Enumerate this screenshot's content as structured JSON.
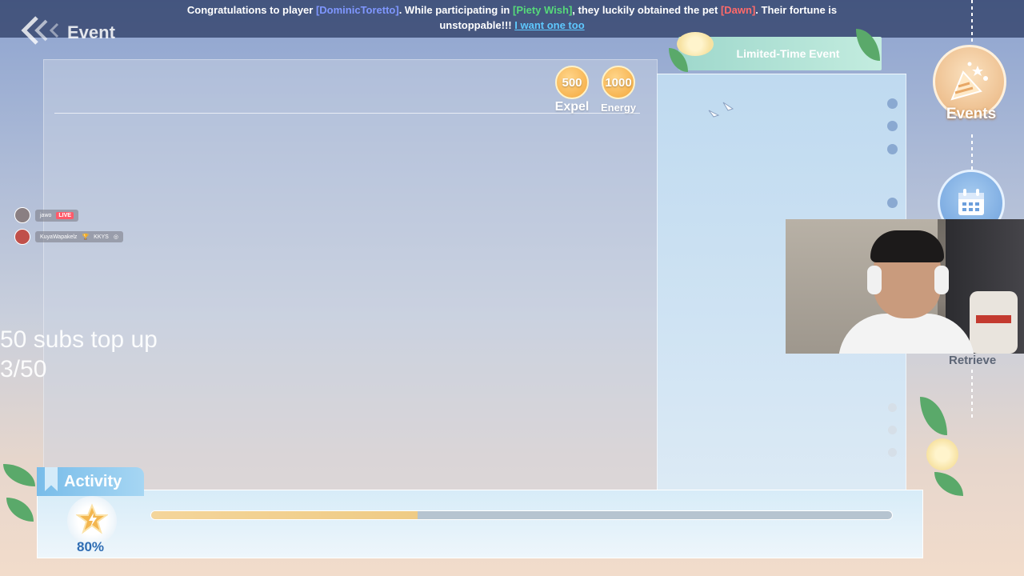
{
  "announcement": {
    "line1_a": "Congratulations to player ",
    "player": "[DominicToretto]",
    "line1_b": ". While participating in ",
    "event": "[Piety Wish]",
    "line1_c": ", they luckily obtained the pet ",
    "pet": "[Dawn]",
    "line1_d": ". Their fortune is",
    "line2": "unstoppable!!! ",
    "link": "I want one too",
    "colors": {
      "player": "#7f97ff",
      "event": "#56d97a",
      "pet": "#ff6a6a",
      "link": "#5ec8ff"
    }
  },
  "header": {
    "back_icon": "back-arrow-icon",
    "title": "Event"
  },
  "currencies": [
    {
      "amount": "500",
      "label": "Expel"
    },
    {
      "amount": "1000",
      "label": "Energy"
    }
  ],
  "side_panel": {
    "tab_label": "Limited-Time Event"
  },
  "nav": {
    "events_label": "Events",
    "events_icon": "party-popper-icon",
    "calendar_icon": "calendar-icon",
    "retrieve_label": "Retrieve"
  },
  "stream_chat": [
    {
      "user": "jawo",
      "badge": "LIVE"
    },
    {
      "user": "KuyaWapakelz",
      "badge": "KKYS"
    }
  ],
  "overlay": {
    "line1": "50 subs top up",
    "line2": "3/50"
  },
  "activity": {
    "label": "Activity",
    "icon": "star-icon",
    "percent_text": "80%",
    "progress": 0.36
  }
}
